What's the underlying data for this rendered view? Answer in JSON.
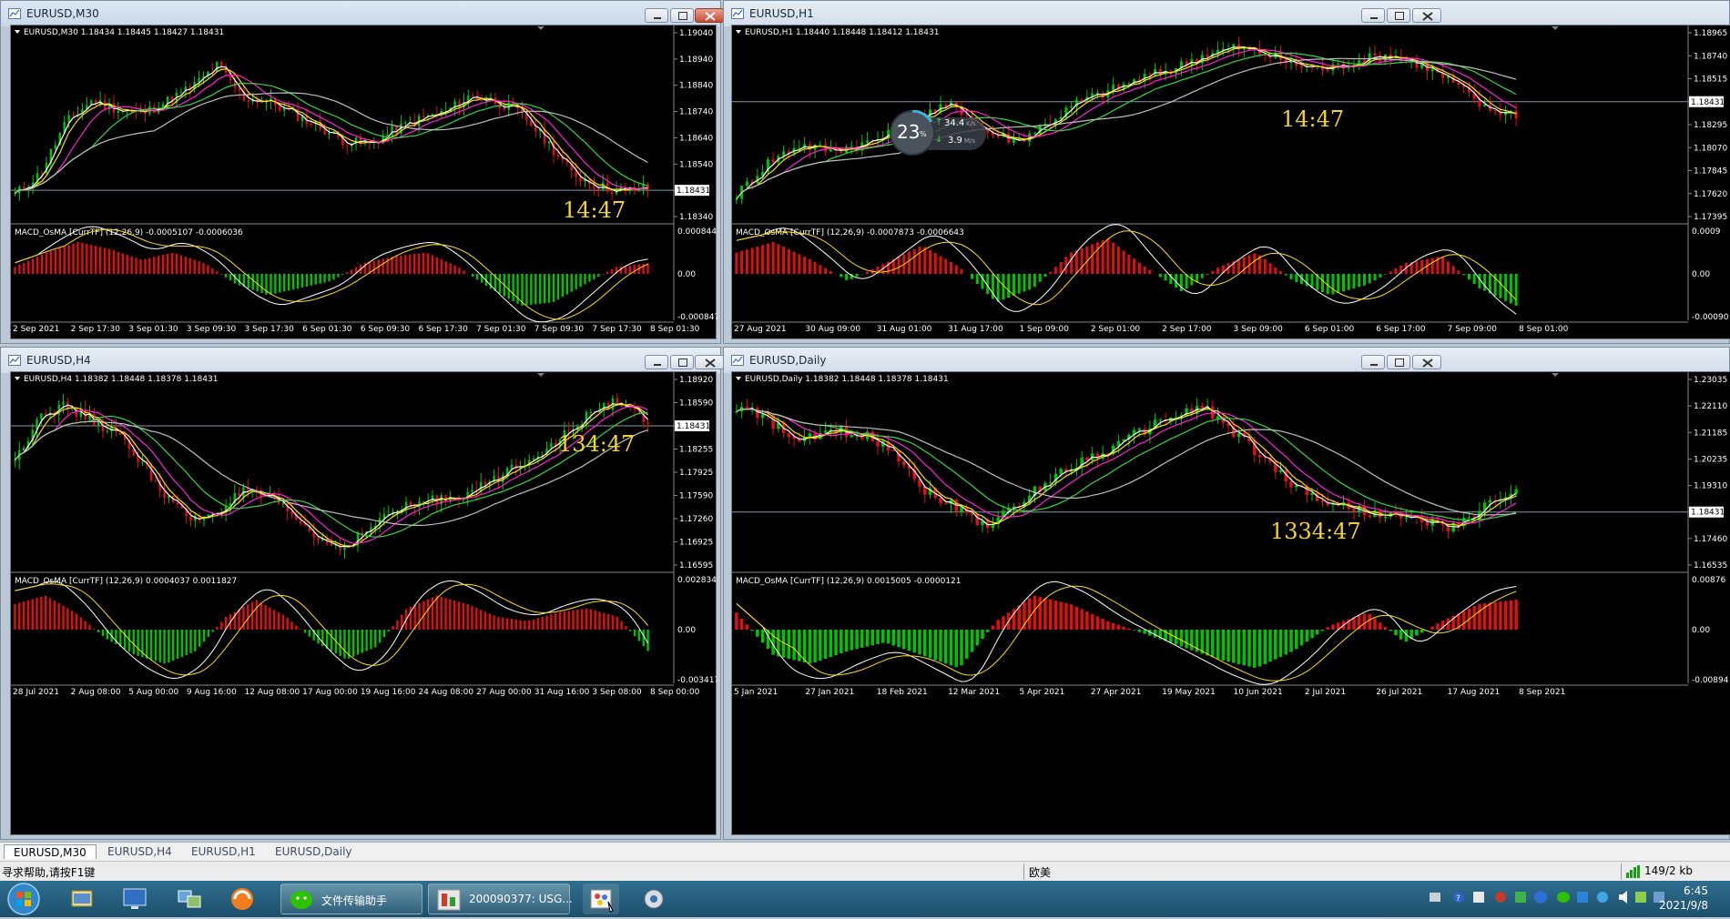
{
  "windows": [
    {
      "id": "m30",
      "title": "EURUSD,M30",
      "active": true,
      "header": "EURUSD,M30  1.18434 1.18445 1.18427 1.18431",
      "price_ticks": [
        "1.19040",
        "1.18940",
        "1.18840",
        "1.18740",
        "1.18640",
        "1.18540",
        "1.18431",
        "1.18340"
      ],
      "current_price": "1.18431",
      "indicator_header": "MACD_OsMA [CurrTF] (12,26,9) -0.0005107 -0.0006036",
      "indicator_ticks": [
        "0.0008442",
        "0.00",
        "-0.000847"
      ],
      "time_labels": [
        "2 Sep 2021",
        "2 Sep 17:30",
        "3 Sep 01:30",
        "3 Sep 09:30",
        "3 Sep 17:30",
        "6 Sep 01:30",
        "6 Sep 09:30",
        "6 Sep 17:30",
        "7 Sep 01:30",
        "7 Sep 09:30",
        "7 Sep 17:30",
        "8 Sep 01:30"
      ],
      "countdown": "14:47"
    },
    {
      "id": "h1",
      "title": "EURUSD,H1",
      "active": false,
      "header": "EURUSD,H1  1.18440 1.18448 1.18412 1.18431",
      "price_ticks": [
        "1.18965",
        "1.18740",
        "1.18515",
        "1.18431",
        "1.18295",
        "1.18070",
        "1.17845",
        "1.17620",
        "1.17395"
      ],
      "current_price": "1.18431",
      "indicator_header": "MACD_OsMA [CurrTF] (12,26,9) -0.0007873 -0.0006643",
      "indicator_ticks": [
        "0.0009",
        "0.00",
        "-0.00090"
      ],
      "time_labels": [
        "27 Aug 2021",
        "30 Aug 09:00",
        "31 Aug 01:00",
        "31 Aug 17:00",
        "1 Sep 09:00",
        "2 Sep 01:00",
        "2 Sep 17:00",
        "3 Sep 09:00",
        "6 Sep 01:00",
        "6 Sep 17:00",
        "7 Sep 09:00",
        "8 Sep 01:00"
      ],
      "countdown": "14:47",
      "speed_widget": {
        "percent": "23",
        "unit": "%",
        "up": "34.4",
        "up_unit": "K/s",
        "down": "3.9",
        "down_unit": "M/s"
      }
    },
    {
      "id": "h4",
      "title": "EURUSD,H4",
      "active": false,
      "header": "EURUSD,H4  1.18382 1.18448 1.18378 1.18431",
      "price_ticks": [
        "1.18920",
        "1.18590",
        "1.18431",
        "1.18255",
        "1.17925",
        "1.17590",
        "1.17260",
        "1.16925",
        "1.16595"
      ],
      "current_price": "1.18431",
      "indicator_header": "MACD_OsMA [CurrTF] (12,26,9) 0.0004037 0.0011827",
      "indicator_ticks": [
        "0.0028346",
        "0.00",
        "-0.003417"
      ],
      "time_labels": [
        "28 Jul 2021",
        "2 Aug 08:00",
        "5 Aug 00:00",
        "9 Aug 16:00",
        "12 Aug 08:00",
        "17 Aug 00:00",
        "19 Aug 16:00",
        "24 Aug 08:00",
        "27 Aug 00:00",
        "31 Aug 16:00",
        "3 Sep 08:00",
        "8 Sep 00:00"
      ],
      "countdown": "134:47"
    },
    {
      "id": "d1",
      "title": "EURUSD,Daily",
      "active": false,
      "header": "EURUSD,Daily  1.18382 1.18448 1.18378 1.18431",
      "price_ticks": [
        "1.23035",
        "1.22110",
        "1.21185",
        "1.20235",
        "1.19310",
        "1.18431",
        "1.17460",
        "1.16535"
      ],
      "current_price": "1.18431",
      "indicator_header": "MACD_OsMA [CurrTF] (12,26,9) 0.0015005 -0.0000121",
      "indicator_ticks": [
        "0.00876",
        "0.00",
        "-0.00894"
      ],
      "time_labels": [
        "5 Jan 2021",
        "27 Jan 2021",
        "18 Feb 2021",
        "12 Mar 2021",
        "5 Apr 2021",
        "27 Apr 2021",
        "19 May 2021",
        "10 Jun 2021",
        "2 Jul 2021",
        "26 Jul 2021",
        "17 Aug 2021",
        "8 Sep 2021"
      ],
      "countdown": "1334:47"
    }
  ],
  "chart_tabs": [
    "EURUSD,M30",
    "EURUSD,H4",
    "EURUSD,H1",
    "EURUSD,Daily"
  ],
  "status": {
    "help": "寻求帮助,请按F1键",
    "profile": "欧美",
    "traffic": "149/2 kb"
  },
  "taskbar": {
    "items": [
      {
        "label": "文件传输助手",
        "icon": "wechat-icon"
      },
      {
        "label": "200090377: USG...",
        "icon": "metatrader-icon"
      }
    ],
    "time": "6:45",
    "date": "2021/9/8"
  },
  "colors": {
    "bull": "#00c400",
    "bear": "#e01010",
    "ma_white": "#ffffff",
    "ma_yellow": "#ffe000",
    "ma_magenta": "#ff20d8",
    "ma_green": "#30d840",
    "ma_gray": "#bfbfbf",
    "countdown": "#f4d22c"
  }
}
